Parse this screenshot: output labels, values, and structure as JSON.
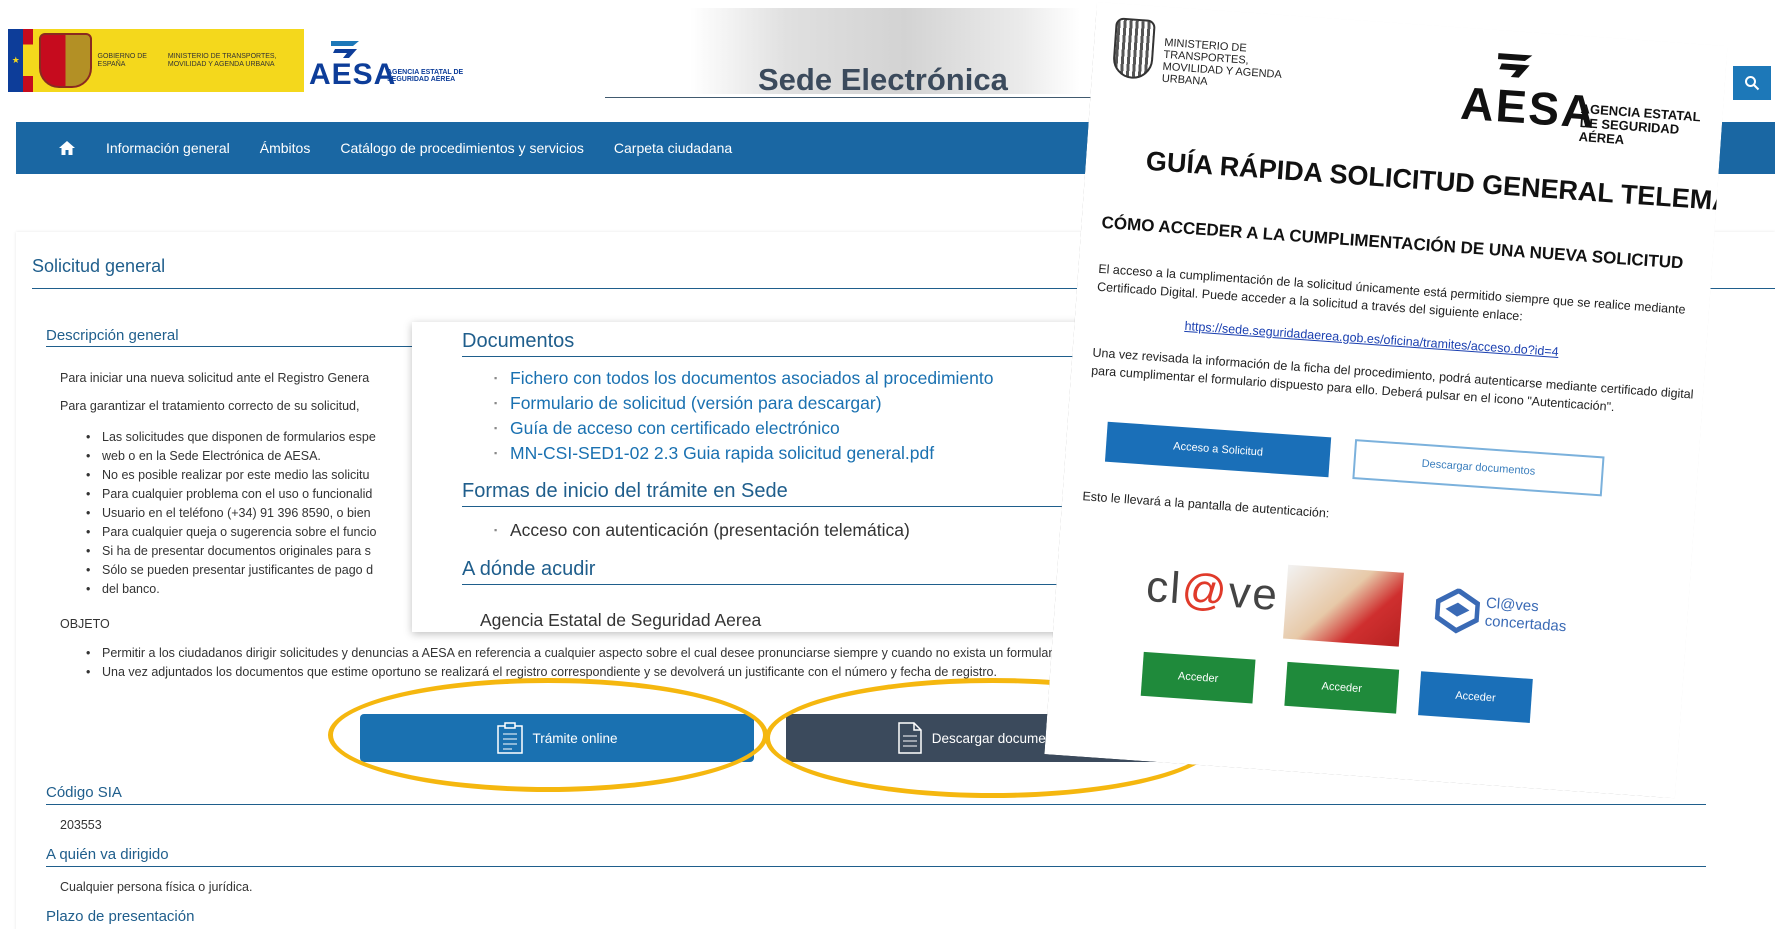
{
  "header": {
    "gov_text": "GOBIERNO DE ESPAÑA",
    "ministry_text": "MINISTERIO DE TRANSPORTES, MOVILIDAD Y AGENDA URBANA",
    "aesa_word": "AESA",
    "aesa_sub": "AGENCIA ESTATAL DE SEGURIDAD AÉREA",
    "site_title": "Sede Electrónica"
  },
  "nav": {
    "items": [
      "Información general",
      "Ámbitos",
      "Catálogo de procedimientos y servicios",
      "Carpeta ciudadana"
    ]
  },
  "page": {
    "title": "Solicitud general",
    "descripcion_head": "Descripción general",
    "intro_1": "Para iniciar una nueva solicitud ante el Registro Genera",
    "intro_2": "Para garantizar el tratamiento correcto de su solicitud,",
    "bullets": [
      "Las solicitudes que disponen de formularios espe",
      "web o en la Sede Electrónica de AESA.",
      "No es posible realizar por este medio las solicitu",
      "Para cualquier problema con el uso o funcionalid",
      "Usuario en el teléfono (+34) 91 396 8590, o bien",
      "Para cualquier queja o sugerencia sobre el funcio",
      "Si ha de presentar documentos originales para s",
      "Sólo se pueden presentar justificantes de pago d",
      "del banco."
    ],
    "objeto_label": "OBJETO",
    "objeto_bullets": [
      "Permitir a los ciudadanos dirigir solicitudes y denuncias a AESA en referencia a cualquier aspecto sobre el cual desee pronunciarse siempre y cuando no exista un formulario esp",
      "Una vez adjuntados los documentos que estime oportuno se realizará el registro correspondiente y se devolverá un justificante con el número y fecha de registro."
    ],
    "btn_tramite": "Trámite online",
    "btn_descargar": "Descargar documentos",
    "codigo_head": "Código SIA",
    "codigo_value": "203553",
    "quien_head": "A quién va dirigido",
    "quien_value": "Cualquier persona física o jurídica.",
    "plazo_head": "Plazo de presentación"
  },
  "documents_overlay": {
    "documentos_head": "Documentos",
    "documentos_links": [
      "Fichero con todos los documentos asociados al procedimiento",
      "Formulario de solicitud (versión para descargar)",
      "Guía de acceso con certificado electrónico",
      "MN-CSI-SED1-02 2.3 Guia rapida solicitud general.pdf"
    ],
    "formas_head": "Formas de inicio del trámite en Sede",
    "formas_item": "Acceso con autenticación (presentación telemática)",
    "donde_head": "A dónde acudir",
    "donde_value": "Agencia Estatal de Seguridad Aerea"
  },
  "guide": {
    "ministry": "MINISTERIO DE TRANSPORTES, MOVILIDAD Y AGENDA URBANA",
    "aesa_word": "AESA",
    "aesa_sub": "AGENCIA ESTATAL DE SEGURIDAD AÉREA",
    "title": "GUÍA RÁPIDA SOLICITUD GENERAL TELEMÁTICA",
    "subtitle": "CÓMO ACCEDER A LA CUMPLIMENTACIÓN DE UNA NUEVA SOLICITUD",
    "text_1": "El acceso a la cumplimentación de la solicitud únicamente está permitido siempre que se realice mediante",
    "text_2": "Certificado Digital. Puede acceder a la solicitud a través del siguiente enlace:",
    "link": "https://sede.seguridadaerea.gob.es/oficina/tramites/acceso.do?id=4",
    "text_3": "Una vez revisada la información de la ficha del procedimiento, podrá autenticarse mediante certificado digital",
    "text_4": "para cumplimentar el formulario dispuesto para ello. Deberá pulsar en el icono \"Autenticación\".",
    "btn_acceso": "Acceso a Solicitud",
    "btn_descargar": "Descargar documentos",
    "text_5": "Esto le llevará a la pantalla de autenticación:",
    "clave_pre": "cl",
    "clave_at": "@",
    "clave_post": "ve",
    "concertadas_1": "Cl@ves",
    "concertadas_2": "concertadas",
    "acceder": "Acceder"
  },
  "colors": {
    "nav_bg": "#1a67a3",
    "heading_blue": "#1f5e8c",
    "btn_tramite": "#1a71b1",
    "btn_descargar": "#3b4a5c",
    "highlight": "#f5b70f"
  }
}
